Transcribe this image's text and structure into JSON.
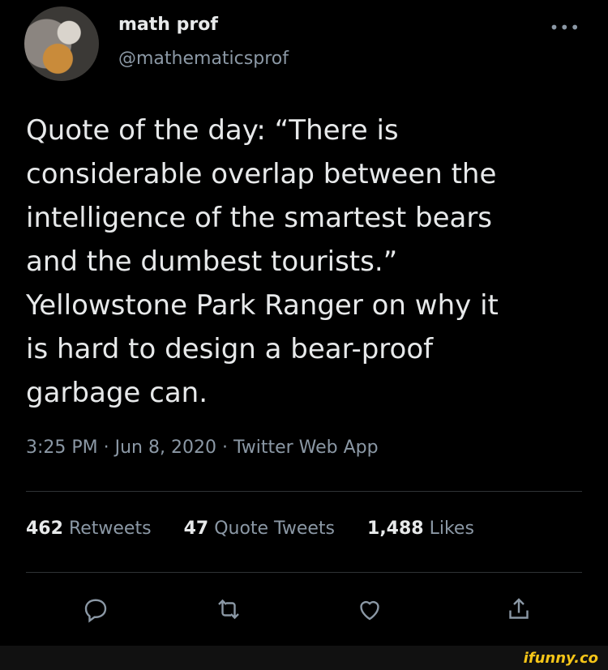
{
  "author": {
    "name": "math prof",
    "handle": "@mathematicsprof"
  },
  "menu": {
    "more_label": "•••"
  },
  "tweet": {
    "text": "Quote of the day:  “There is\nconsiderable overlap between the\nintelligence of the smartest bears\nand the dumbest tourists.”\nYellowstone Park Ranger on why it\nis hard to design a bear-proof\ngarbage can.",
    "meta": "3:25 PM · Jun 8, 2020 · Twitter Web App"
  },
  "stats": [
    {
      "count": "462",
      "label": "Retweets"
    },
    {
      "count": "47",
      "label": "Quote Tweets"
    },
    {
      "count": "1,488",
      "label": "Likes"
    }
  ],
  "actions": [
    {
      "icon": "reply-icon"
    },
    {
      "icon": "retweet-icon"
    },
    {
      "icon": "like-icon"
    },
    {
      "icon": "share-icon"
    }
  ],
  "watermark": "ifunny.co",
  "colors": {
    "background": "#000000",
    "text": "#e7e9ea",
    "secondary": "#8b98a5",
    "divider": "#2f3336",
    "watermark": "#f5c518"
  }
}
